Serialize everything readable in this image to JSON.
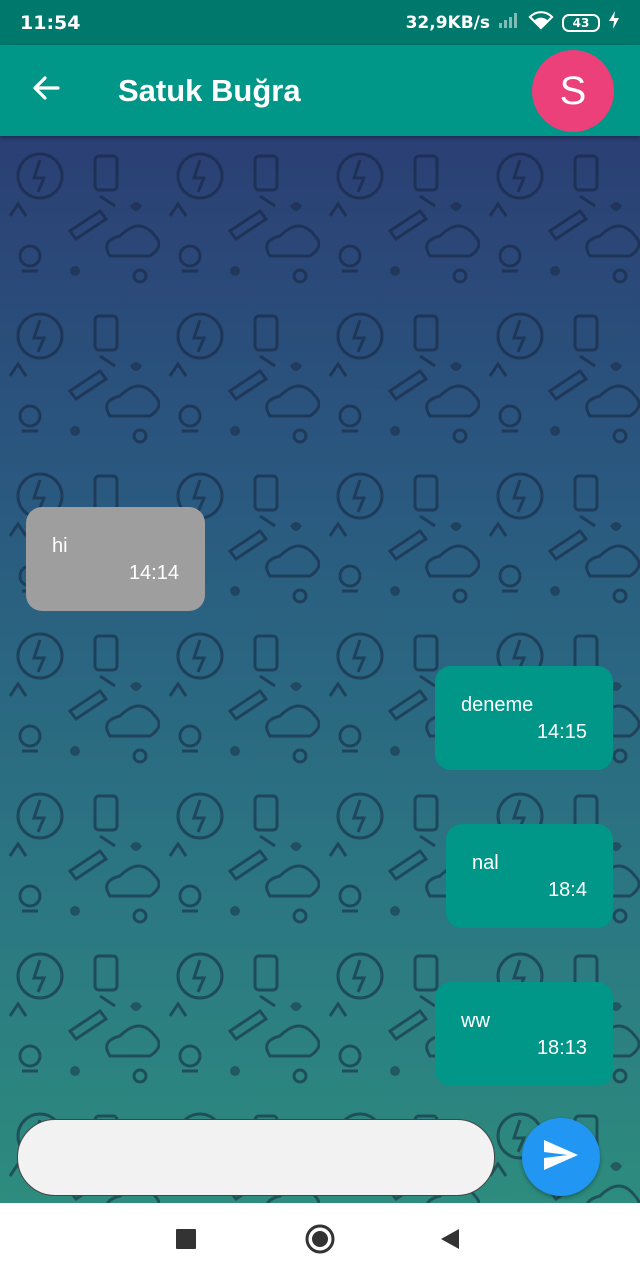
{
  "status_bar": {
    "time": "11:54",
    "network_speed": "32,9KB/s",
    "battery_level": "43",
    "icons": [
      "signal-icon",
      "wifi-icon",
      "battery-icon",
      "charging-icon"
    ]
  },
  "app_bar": {
    "back_icon": "arrow-left-icon",
    "title": "Satuk Buğra",
    "avatar_letter": "S",
    "avatar_color": "#ec407a",
    "bar_color": "#009688"
  },
  "messages": [
    {
      "direction": "incoming",
      "text": "hi",
      "time": "14:14"
    },
    {
      "direction": "outgoing",
      "text": "deneme",
      "time": "14:15"
    },
    {
      "direction": "outgoing",
      "text": "nal",
      "time": "18:4"
    },
    {
      "direction": "outgoing",
      "text": "ww",
      "time": "18:13"
    }
  ],
  "composer": {
    "input_value": "",
    "placeholder": "",
    "send_icon": "send-icon",
    "send_color": "#2196f3"
  },
  "nav_bar": {
    "buttons": [
      "recents-square-icon",
      "home-circle-icon",
      "back-triangle-icon"
    ]
  },
  "colors": {
    "incoming_bubble": "#9e9e9e",
    "outgoing_bubble": "#009688",
    "status_bar": "#00786b"
  }
}
